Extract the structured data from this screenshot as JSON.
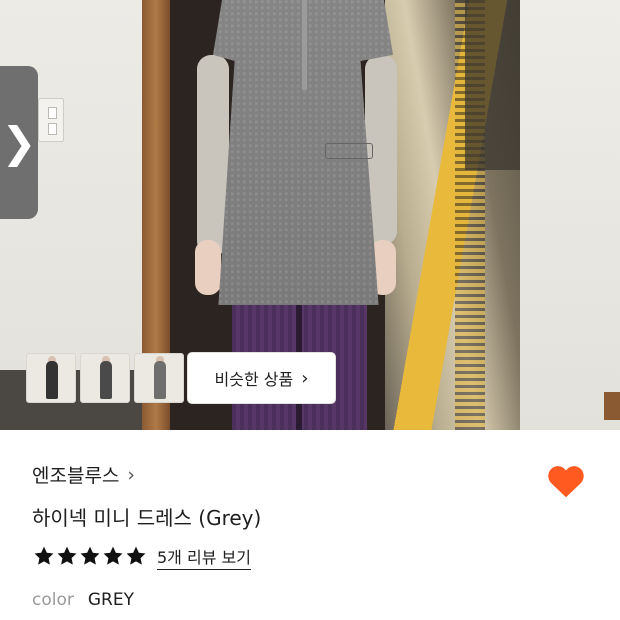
{
  "gallery": {
    "prev_icon": "chevron-right-icon",
    "prev_glyph": "❯",
    "thumbnails_count": 3,
    "similar_button_label": "비슷한 상품",
    "similar_button_chevron": "›"
  },
  "product": {
    "brand": "엔조블루스",
    "brand_chevron": "›",
    "title": "하이넥 미니 드레스 (Grey)",
    "wishlist_icon": "heart-icon",
    "wishlist_color": "#FF5A1F",
    "rating_stars": 5,
    "star_color": "#111111",
    "review_link": "5개 리뷰 보기",
    "color_label": "color",
    "color_value": "GREY"
  }
}
